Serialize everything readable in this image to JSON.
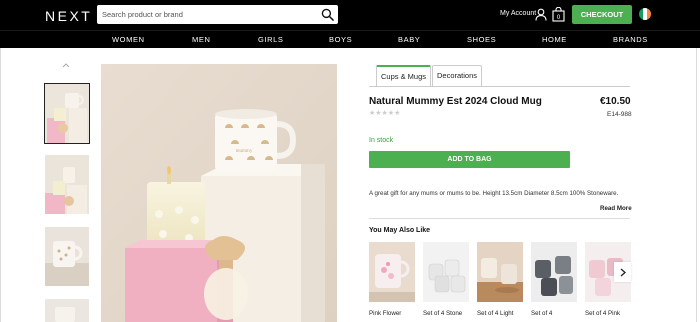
{
  "header": {
    "logo": "NEXT",
    "search_placeholder": "Search product or brand",
    "account_label": "My Account",
    "bag_count": "0",
    "checkout_label": "CHECKOUT",
    "nav": [
      "WOMEN",
      "MEN",
      "GIRLS",
      "BOYS",
      "BABY",
      "SHOES",
      "HOME",
      "BRANDS"
    ]
  },
  "gallery": {
    "thumbnails": [
      "thumbnail-1",
      "thumbnail-2",
      "thumbnail-3",
      "thumbnail-4"
    ],
    "selected_index": 0
  },
  "product": {
    "tabs": [
      "Cups & Mugs",
      "Decorations"
    ],
    "active_tab": "Cups & Mugs",
    "title": "Natural Mummy Est 2024 Cloud Mug",
    "price": "€10.50",
    "code": "E14-988",
    "rating_stars": 0,
    "stock_status": "In stock",
    "add_to_bag_label": "ADD TO BAG",
    "description": "A great gift for any mums or mums to be. Height 13.5cm Diameter 8.5cm 100% Stoneware.",
    "read_more_label": "Read More"
  },
  "recommendations": {
    "heading": "You May Also Like",
    "items": [
      {
        "label": "Pink Flower"
      },
      {
        "label": "Set of 4 Stone"
      },
      {
        "label": "Set of 4 Light"
      },
      {
        "label": "Set of 4"
      },
      {
        "label": "Set of 4 Pink"
      }
    ]
  },
  "colors": {
    "accent_green": "#4caf50",
    "header_bg": "#000000",
    "stock_green": "#3a9b3e"
  },
  "icons": [
    "search-icon",
    "user-icon",
    "bag-icon",
    "ireland-flag-icon",
    "chevron-up-icon",
    "chevron-right-icon"
  ]
}
